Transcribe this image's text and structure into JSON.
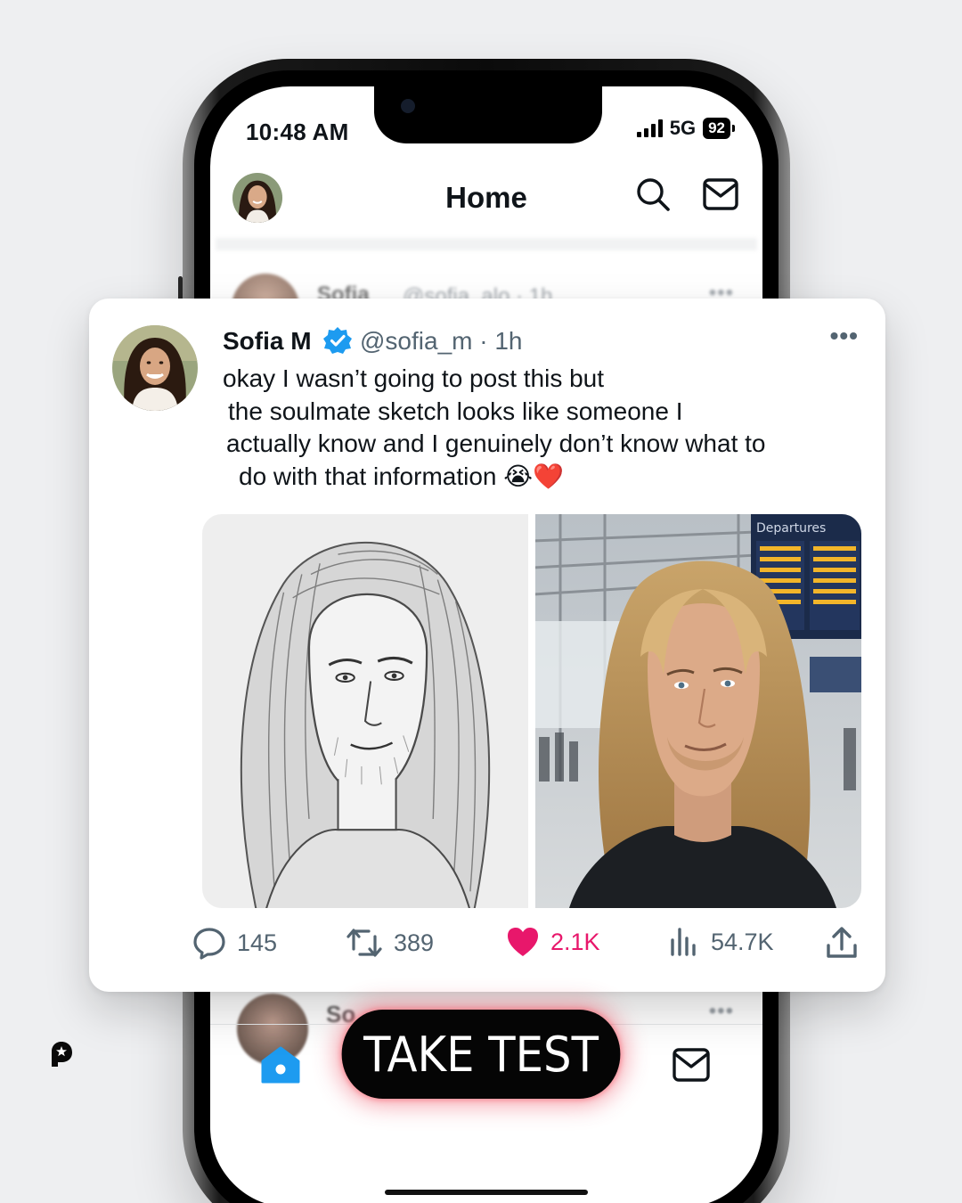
{
  "status_bar": {
    "time": "10:48 AM",
    "network": "5G",
    "battery": "92"
  },
  "header": {
    "title": "Home"
  },
  "background_post": {
    "name": "Sofia",
    "handle": "@sofia_alo · 1h",
    "more": "•••"
  },
  "background_post2": {
    "name": "So",
    "more": "•••"
  },
  "tweet": {
    "name": "Sofia M",
    "handle": "@sofia_m · 1h",
    "more": "•••",
    "text_lines": [
      "okay I wasn’t going to post this but",
      "the soulmate sketch looks like someone I",
      "actually know and I genuinely don’t know what to",
      "do with that information 😭❤️"
    ],
    "media_left_desc": "pencil sketch portrait",
    "media_right_desc": "photo at airport",
    "airport_sign": "Departures",
    "actions": {
      "replies": "145",
      "retweets": "389",
      "likes": "2.1K",
      "views": "54.7K"
    }
  },
  "cta": {
    "label": "TAKE TEST"
  },
  "colors": {
    "like": "#e8176b",
    "verified": "#1d9bf0",
    "home_tab": "#1d9bf0"
  }
}
